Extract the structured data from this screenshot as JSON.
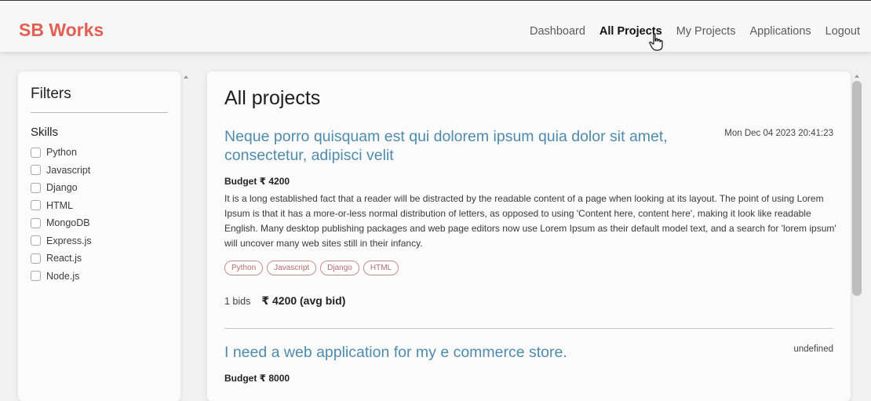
{
  "header": {
    "brand": "SB Works",
    "nav": [
      "Dashboard",
      "All Projects",
      "My Projects",
      "Applications",
      "Logout"
    ],
    "active_nav": "All Projects"
  },
  "filters": {
    "title": "Filters",
    "skills_title": "Skills",
    "skills": [
      "Python",
      "Javascript",
      "Django",
      "HTML",
      "MongoDB",
      "Express.js",
      "React.js",
      "Node.js"
    ]
  },
  "main": {
    "title": "All projects",
    "projects": [
      {
        "title": "Neque porro quisquam est qui dolorem ipsum quia dolor sit amet, consectetur, adipisci velit",
        "date": "Mon Dec 04 2023 20:41:23",
        "budget": "Budget ₹ 4200",
        "description": "It is a long established fact that a reader will be distracted by the readable content of a page when looking at its layout. The point of using Lorem Ipsum is that it has a more-or-less normal distribution of letters, as opposed to using 'Content here, content here', making it look like readable English. Many desktop publishing packages and web page editors now use Lorem Ipsum as their default model text, and a search for 'lorem ipsum' will uncover many web sites still in their infancy.",
        "tags": [
          "Python",
          "Javascript",
          "Django",
          "HTML"
        ],
        "bids": "1 bids",
        "avg_bid": "₹ 4200 (avg bid)"
      },
      {
        "title": "I need a web application for my e commerce store.",
        "date": "undefined",
        "budget": "Budget ₹ 8000"
      }
    ]
  },
  "colors": {
    "brand": "#e25f54",
    "project_title": "#4f8bad",
    "tag_text": "#b46a6a",
    "tag_border": "#c78b8b"
  },
  "icons": {
    "cursor": "hand-pointer-icon",
    "scroll_up": "scroll-up-arrow-icon"
  }
}
